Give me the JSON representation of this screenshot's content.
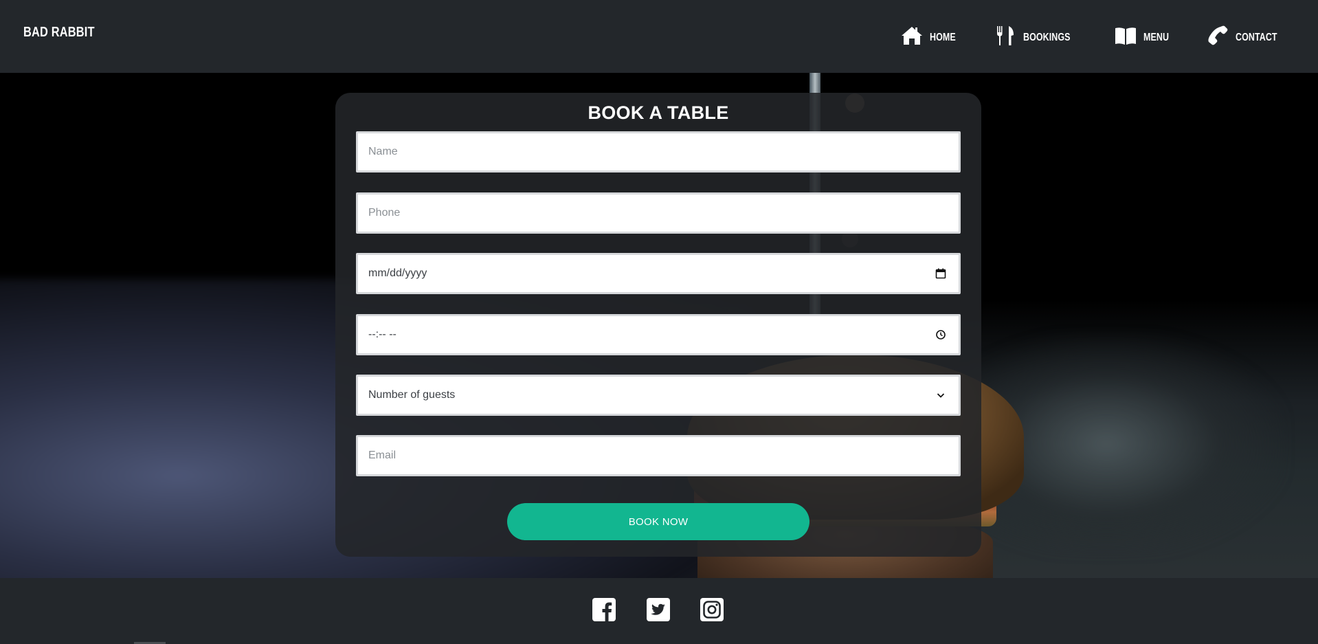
{
  "header": {
    "brand": "BAD RABBIT",
    "nav": [
      {
        "label": "HOME",
        "icon": "home-icon"
      },
      {
        "label": "BOOKINGS",
        "icon": "utensils-icon"
      },
      {
        "label": "MENU",
        "icon": "book-icon"
      },
      {
        "label": "CONTACT",
        "icon": "phone-icon"
      }
    ]
  },
  "booking": {
    "title": "BOOK A TABLE",
    "name_placeholder": "Name",
    "phone_placeholder": "Phone",
    "date_placeholder": "mm/dd/yyyy",
    "time_placeholder": "--:-- --",
    "guests_selected": "Number of guests",
    "email_placeholder": "Email",
    "submit_label": "BOOK NOW"
  },
  "footer": {
    "social": [
      "facebook-icon",
      "twitter-icon",
      "instagram-icon"
    ]
  },
  "colors": {
    "header_bg": "#23272b",
    "accent": "#12b690",
    "card_bg": "rgba(35,38,41,0.88)"
  }
}
